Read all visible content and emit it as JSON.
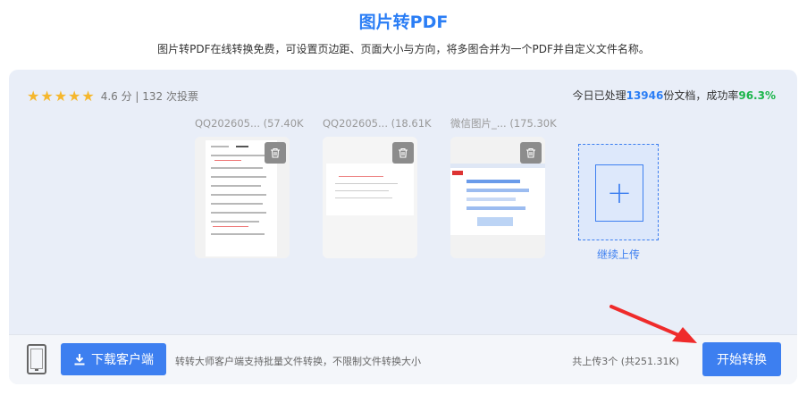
{
  "header": {
    "title": "图片转PDF",
    "subtitle": "图片转PDF在线转换免费，可设置页边距、页面大小与方向，将多图合并为一个PDF并自定义文件名称。"
  },
  "rating": {
    "stars": "★★★★★",
    "score": "4.6 分 | 132 次投票"
  },
  "stats": {
    "prefix": "今日已处理",
    "count": "13946",
    "middle": "份文档，成功率",
    "rate": "96.3%"
  },
  "files": [
    {
      "name": "QQ202605... (57.40K"
    },
    {
      "name": "QQ202605... (18.61K"
    },
    {
      "name": "微信图片_... (175.30K"
    }
  ],
  "add_more": {
    "label": "继续上传"
  },
  "bottom": {
    "download_label": "下载客户端",
    "client_note": "转转大师客户端支持批量文件转换，不限制文件转换大小",
    "total": "共上传3个 (共251.31K)",
    "start_label": "开始转换"
  },
  "colors": {
    "accent": "#3d7ff0",
    "star": "#f5b72d",
    "success": "#1bb54b"
  }
}
